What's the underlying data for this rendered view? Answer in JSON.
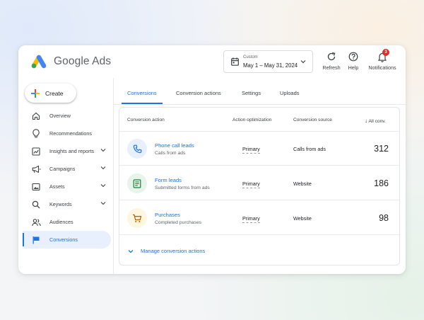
{
  "app": {
    "name": "Google Ads"
  },
  "header": {
    "date_picker": {
      "label": "Custom",
      "range": "May 1 – May 31, 2024"
    },
    "actions": [
      {
        "label": "Refresh",
        "icon": "refresh-icon"
      },
      {
        "label": "Help",
        "icon": "help-icon"
      },
      {
        "label": "Notifications",
        "icon": "bell-icon",
        "badge": "3"
      }
    ]
  },
  "sidebar": {
    "create_label": "Create",
    "items": [
      {
        "label": "Overview",
        "icon": "home-icon"
      },
      {
        "label": "Recommendations",
        "icon": "lightbulb-icon"
      },
      {
        "label": "Insights and reports",
        "icon": "chart-icon"
      },
      {
        "label": "Campaigns",
        "icon": "megaphone-icon"
      },
      {
        "label": "Assets",
        "icon": "image-icon"
      },
      {
        "label": "Keywords",
        "icon": "search-icon"
      },
      {
        "label": "Audiences",
        "icon": "people-icon"
      },
      {
        "label": "Conversions",
        "icon": "flag-icon",
        "active": true
      }
    ]
  },
  "tabs": [
    {
      "label": "Conversions",
      "active": true
    },
    {
      "label": "Conversion actions"
    },
    {
      "label": "Settings"
    },
    {
      "label": "Uploads"
    }
  ],
  "table": {
    "columns": [
      "Conversion action",
      "Action optimization",
      "Conversion source",
      "All conv."
    ],
    "sort_indicator": "↓",
    "rows": [
      {
        "title": "Phone call leads",
        "subtitle": "Calls from ads",
        "optimization": "Primary",
        "source": "Calls from ads",
        "value": "312",
        "icon": "phone-icon"
      },
      {
        "title": "Form leads",
        "subtitle": "Submitted forms from ads",
        "optimization": "Primary",
        "source": "Website",
        "value": "186",
        "icon": "form-icon"
      },
      {
        "title": "Purchases",
        "subtitle": "Completed purchases",
        "optimization": "Primary",
        "source": "Website",
        "value": "98",
        "icon": "cart-icon"
      }
    ],
    "footer_link": "Manage conversion actions"
  },
  "colors": {
    "accent": "#1a73e8",
    "phone_bg": "#e8f0fe",
    "form_bg": "#e6f4ea",
    "form_fg": "#188038",
    "cart_bg": "#fef7e0",
    "cart_fg": "#b06000",
    "badge": "#d93025"
  }
}
